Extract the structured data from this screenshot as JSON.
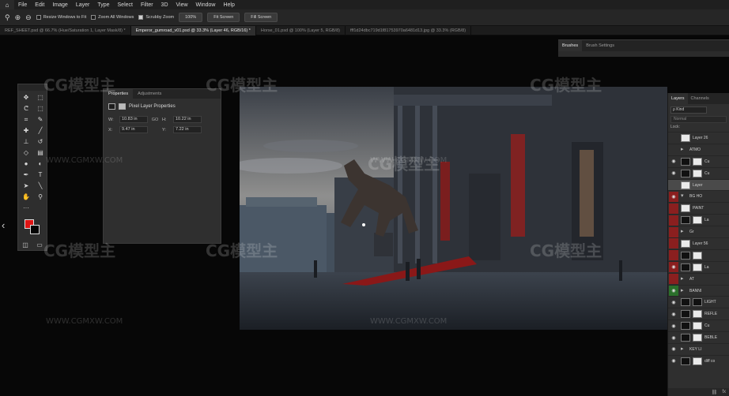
{
  "menubar": {
    "items": [
      "File",
      "Edit",
      "Image",
      "Layer",
      "Type",
      "Select",
      "Filter",
      "3D",
      "View",
      "Window",
      "Help"
    ]
  },
  "options": {
    "resize_windows": "Resize Windows to Fit",
    "zoom_all": "Zoom All Windows",
    "scrubby_zoom": "Scrubby Zoom",
    "zoom_100": "100%",
    "fit_screen": "Fit Screen",
    "fill_screen": "Fill Screen"
  },
  "tabs": [
    "REF_SHEET.psd @ 66.7% (Hue/Saturation 1, Layer Mask/8) *",
    "Emperor_gumroad_v01.psd @ 33.3% (Layer 46, RGB/16) *",
    "Horse_01.psd @ 100% (Layer 5, RGB/8)",
    "fff1d24dbc719d1f81753970a6481d13.jpg @ 33.3% (RGB/8)"
  ],
  "brushes_panel": {
    "tab1": "Brushes",
    "tab2": "Brush Settings"
  },
  "properties": {
    "tab1": "Properties",
    "tab2": "Adjustments",
    "title": "Pixel Layer Properties",
    "w_label": "W:",
    "w": "10.83 in",
    "h_label": "H:",
    "h": "10.22 in",
    "x_label": "X:",
    "x": "9.47 in",
    "y_label": "Y:",
    "y": "7.22 in",
    "link": "GO"
  },
  "layers": {
    "tab1": "Layers",
    "tab2": "Channels",
    "kind": "ρ Kind",
    "blend": "Normal",
    "lock": "Lock:",
    "rows": [
      "Layer 26",
      "ATMO",
      "Cu",
      "Cu",
      "Layer",
      "BG HO",
      "PAINT",
      "La",
      "Gr",
      "Layer 56",
      "",
      "La",
      "AT",
      "BANNI",
      "LIGHT",
      "REFLE",
      "Cu",
      "BEBLE",
      "KEY LI",
      "diff co"
    ],
    "footer": "fx"
  },
  "watermark": {
    "logo": "CG模型主",
    "url": "WWW.CGMXW.COM"
  },
  "colors": {
    "foreground": "#e01414",
    "background": "#050505",
    "accent": "#8a1f1f"
  }
}
